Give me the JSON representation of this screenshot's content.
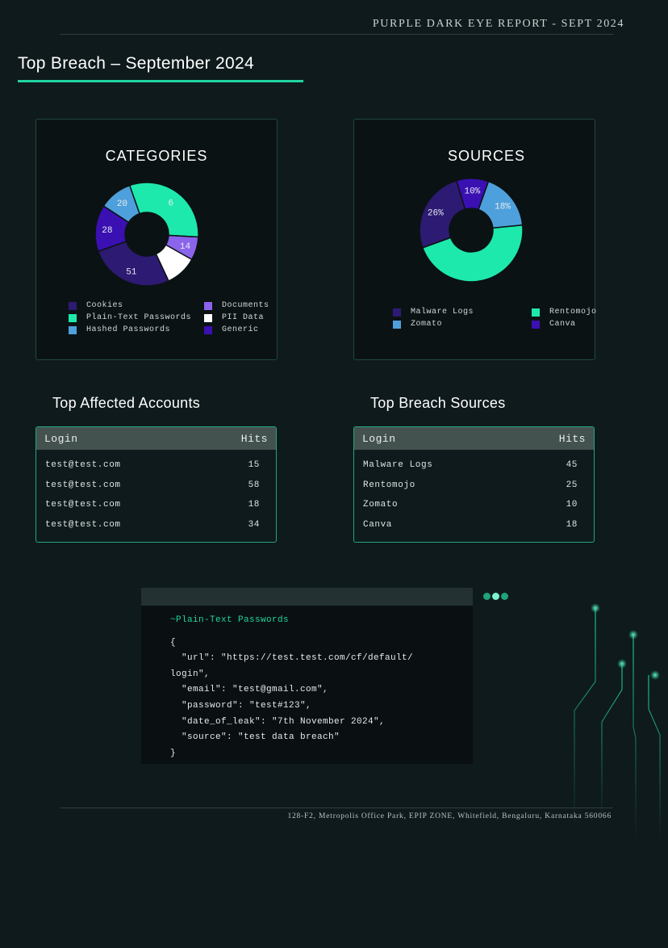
{
  "report_header": "PURPLE DARK EYE REPORT - SEPT 2024",
  "page_title": "Top Breach – September 2024",
  "colors": {
    "accent": "#21d3a0",
    "background": "#0f1a1c",
    "cookies": "#2d1a72",
    "plain_text_passwords": "#1de9ad",
    "hashed_passwords": "#4ea0dc",
    "documents": "#8a64ea",
    "pii_data": "#ffffff",
    "generic": "#3a10b2"
  },
  "chart_data": [
    {
      "type": "pie",
      "title": "CATEGORIES",
      "donut": true,
      "series": [
        {
          "name": "Cookies",
          "value": 51,
          "color": "#2d1a72"
        },
        {
          "name": "Generic",
          "value": 28,
          "color": "#3a10b2"
        },
        {
          "name": "Hashed Passwords",
          "value": 20,
          "color": "#4ea0dc"
        },
        {
          "name": "Plain-Text Passwords",
          "value": 60,
          "color": "#1de9ad"
        },
        {
          "name": "Documents",
          "value": 14,
          "color": "#8a64ea"
        },
        {
          "name": "PII Data",
          "value": 19,
          "color": "#ffffff"
        }
      ],
      "data_labels": [
        {
          "text": "51",
          "series": "Cookies"
        },
        {
          "text": "28",
          "series": "Generic"
        },
        {
          "text": "20",
          "series": "Hashed Passwords"
        },
        {
          "text": "6",
          "series": "Plain-Text Passwords"
        },
        {
          "text": "14",
          "series": "Documents"
        }
      ],
      "legend": [
        {
          "label": "Cookies",
          "color": "#2d1a72"
        },
        {
          "label": "Plain-Text Passwords",
          "color": "#1de9ad"
        },
        {
          "label": "Hashed Passwords",
          "color": "#4ea0dc"
        },
        {
          "label": "Documents",
          "color": "#8a64ea"
        },
        {
          "label": "PII Data",
          "color": "#ffffff"
        },
        {
          "label": "Generic",
          "color": "#3a10b2"
        }
      ]
    },
    {
      "type": "pie",
      "title": "SOURCES",
      "donut": true,
      "series": [
        {
          "name": "Malware Logs",
          "value": 26,
          "color": "#2d1a72"
        },
        {
          "name": "Canva",
          "value": 10,
          "color": "#3a10b2"
        },
        {
          "name": "Zomato",
          "value": 18,
          "color": "#4ea0dc"
        },
        {
          "name": "Rentomojo",
          "value": 46,
          "color": "#1de9ad"
        }
      ],
      "data_labels": [
        {
          "text": "26%",
          "series": "Malware Logs"
        },
        {
          "text": "10%",
          "series": "Canva"
        },
        {
          "text": "18%",
          "series": "Zomato"
        }
      ],
      "legend": [
        {
          "label": "Malware Logs",
          "color": "#2d1a72"
        },
        {
          "label": "Zomato",
          "color": "#4ea0dc"
        },
        {
          "label": "Rentomojo",
          "color": "#1de9ad"
        },
        {
          "label": "Canva",
          "color": "#3a10b2"
        }
      ]
    }
  ],
  "affected_accounts": {
    "title": "Top Affected Accounts",
    "col_login": "Login",
    "col_hits": "Hits",
    "rows": [
      {
        "login": "test@test.com",
        "hits": "15"
      },
      {
        "login": "test@test.com",
        "hits": "58"
      },
      {
        "login": "test@test.com",
        "hits": "18"
      },
      {
        "login": "test@test.com",
        "hits": "34"
      }
    ]
  },
  "breach_sources": {
    "title": "Top Breach Sources",
    "col_login": "Login",
    "col_hits": "Hits",
    "rows": [
      {
        "login": "Malware Logs",
        "hits": "45"
      },
      {
        "login": "Rentomojo",
        "hits": "25"
      },
      {
        "login": "Zomato",
        "hits": "10"
      },
      {
        "login": "Canva",
        "hits": "18"
      }
    ]
  },
  "code_sample": {
    "comment": "~Plain-Text Passwords",
    "lines": [
      "{",
      "  \"url\": \"https://test.test.com/cf/default/",
      "login\",",
      "  \"email\": \"test@gmail.com\",",
      "  \"password\": \"test#123\",",
      "  \"date_of_leak\": \"7th November 2024\",",
      "  \"source\": \"test data breach\"",
      "}"
    ]
  },
  "footer_address": "128-F2, Metropolis Office Park, EPIP ZONE, Whitefield, Bengaluru, Karnataka 560066"
}
